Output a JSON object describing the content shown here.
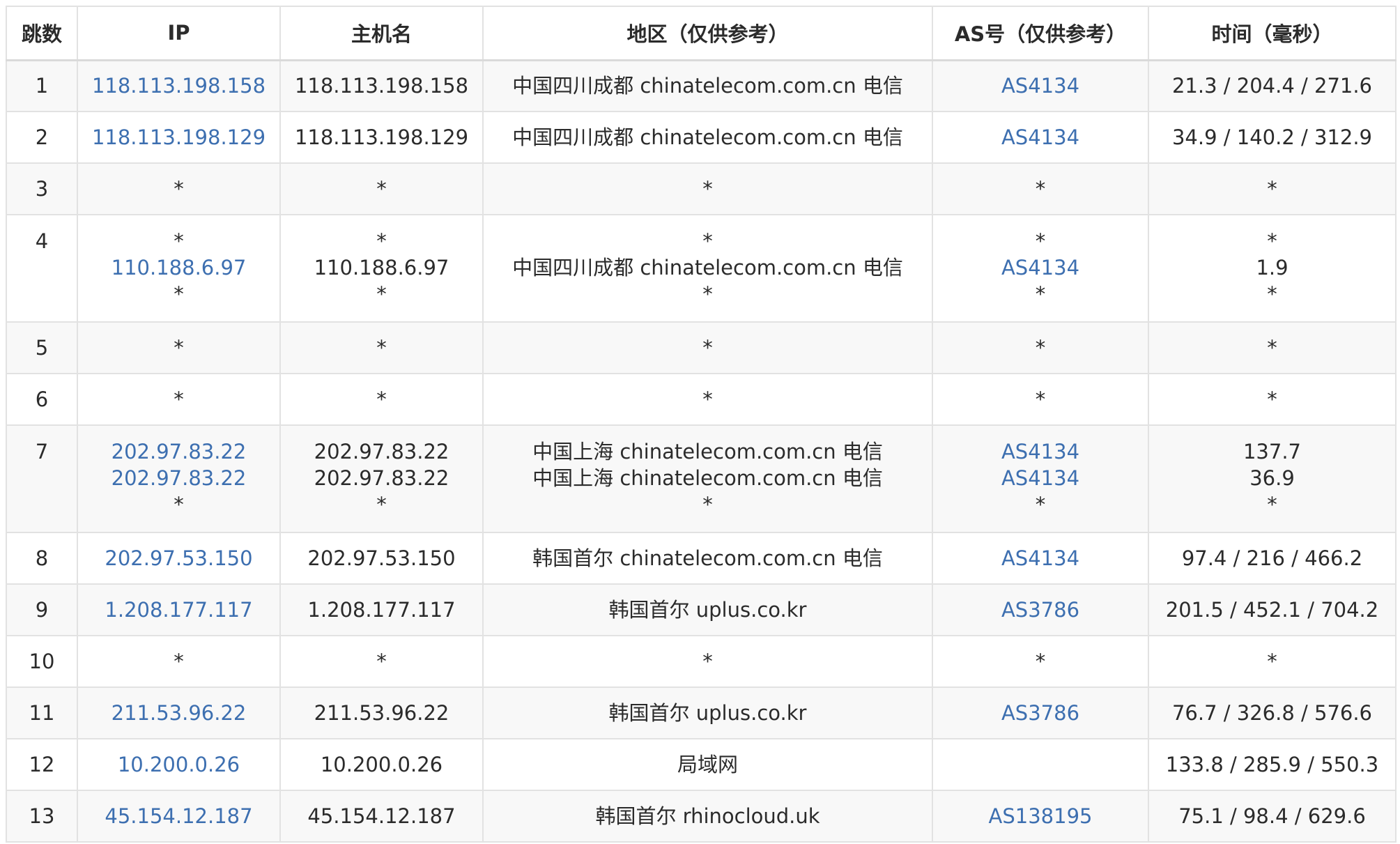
{
  "columns": {
    "hop": "跳数",
    "ip": "IP",
    "hostname": "主机名",
    "region": "地区（仅供参考）",
    "as": "AS号（仅供参考）",
    "time": "时间（毫秒）"
  },
  "link_color": "#3d6fb0",
  "rows": [
    {
      "hop": "1",
      "ip": [
        "118.113.198.158"
      ],
      "hostname": [
        "118.113.198.158"
      ],
      "region": [
        "中国四川成都 chinatelecom.com.cn 电信"
      ],
      "as": [
        "AS4134"
      ],
      "time": [
        "21.3 / 204.4 / 271.6"
      ]
    },
    {
      "hop": "2",
      "ip": [
        "118.113.198.129"
      ],
      "hostname": [
        "118.113.198.129"
      ],
      "region": [
        "中国四川成都 chinatelecom.com.cn 电信"
      ],
      "as": [
        "AS4134"
      ],
      "time": [
        "34.9 / 140.2 / 312.9"
      ]
    },
    {
      "hop": "3",
      "ip": [
        "*"
      ],
      "hostname": [
        "*"
      ],
      "region": [
        "*"
      ],
      "as": [
        "*"
      ],
      "time": [
        "*"
      ]
    },
    {
      "hop": "4",
      "ip": [
        "*",
        "110.188.6.97",
        "*"
      ],
      "hostname": [
        "*",
        "110.188.6.97",
        "*"
      ],
      "region": [
        "*",
        "中国四川成都 chinatelecom.com.cn 电信",
        "*"
      ],
      "as": [
        "*",
        "AS4134",
        "*"
      ],
      "time": [
        "*",
        "1.9",
        "*"
      ]
    },
    {
      "hop": "5",
      "ip": [
        "*"
      ],
      "hostname": [
        "*"
      ],
      "region": [
        "*"
      ],
      "as": [
        "*"
      ],
      "time": [
        "*"
      ]
    },
    {
      "hop": "6",
      "ip": [
        "*"
      ],
      "hostname": [
        "*"
      ],
      "region": [
        "*"
      ],
      "as": [
        "*"
      ],
      "time": [
        "*"
      ]
    },
    {
      "hop": "7",
      "ip": [
        "202.97.83.22",
        "202.97.83.22",
        "*"
      ],
      "hostname": [
        "202.97.83.22",
        "202.97.83.22",
        "*"
      ],
      "region": [
        "中国上海 chinatelecom.com.cn 电信",
        "中国上海 chinatelecom.com.cn 电信",
        "*"
      ],
      "as": [
        "AS4134",
        "AS4134",
        "*"
      ],
      "time": [
        "137.7",
        "36.9",
        "*"
      ]
    },
    {
      "hop": "8",
      "ip": [
        "202.97.53.150"
      ],
      "hostname": [
        "202.97.53.150"
      ],
      "region": [
        "韩国首尔 chinatelecom.com.cn 电信"
      ],
      "as": [
        "AS4134"
      ],
      "time": [
        "97.4 / 216 / 466.2"
      ]
    },
    {
      "hop": "9",
      "ip": [
        "1.208.177.117"
      ],
      "hostname": [
        "1.208.177.117"
      ],
      "region": [
        "韩国首尔 uplus.co.kr"
      ],
      "as": [
        "AS3786"
      ],
      "time": [
        "201.5 / 452.1 / 704.2"
      ]
    },
    {
      "hop": "10",
      "ip": [
        "*"
      ],
      "hostname": [
        "*"
      ],
      "region": [
        "*"
      ],
      "as": [
        "*"
      ],
      "time": [
        "*"
      ]
    },
    {
      "hop": "11",
      "ip": [
        "211.53.96.22"
      ],
      "hostname": [
        "211.53.96.22"
      ],
      "region": [
        "韩国首尔 uplus.co.kr"
      ],
      "as": [
        "AS3786"
      ],
      "time": [
        "76.7 / 326.8 / 576.6"
      ]
    },
    {
      "hop": "12",
      "ip": [
        "10.200.0.26"
      ],
      "hostname": [
        "10.200.0.26"
      ],
      "region": [
        "局域网"
      ],
      "as": [
        ""
      ],
      "time": [
        "133.8 / 285.9 / 550.3"
      ]
    },
    {
      "hop": "13",
      "ip": [
        "45.154.12.187"
      ],
      "hostname": [
        "45.154.12.187"
      ],
      "region": [
        "韩国首尔 rhinocloud.uk"
      ],
      "as": [
        "AS138195"
      ],
      "time": [
        "75.1 / 98.4 / 629.6"
      ]
    }
  ]
}
